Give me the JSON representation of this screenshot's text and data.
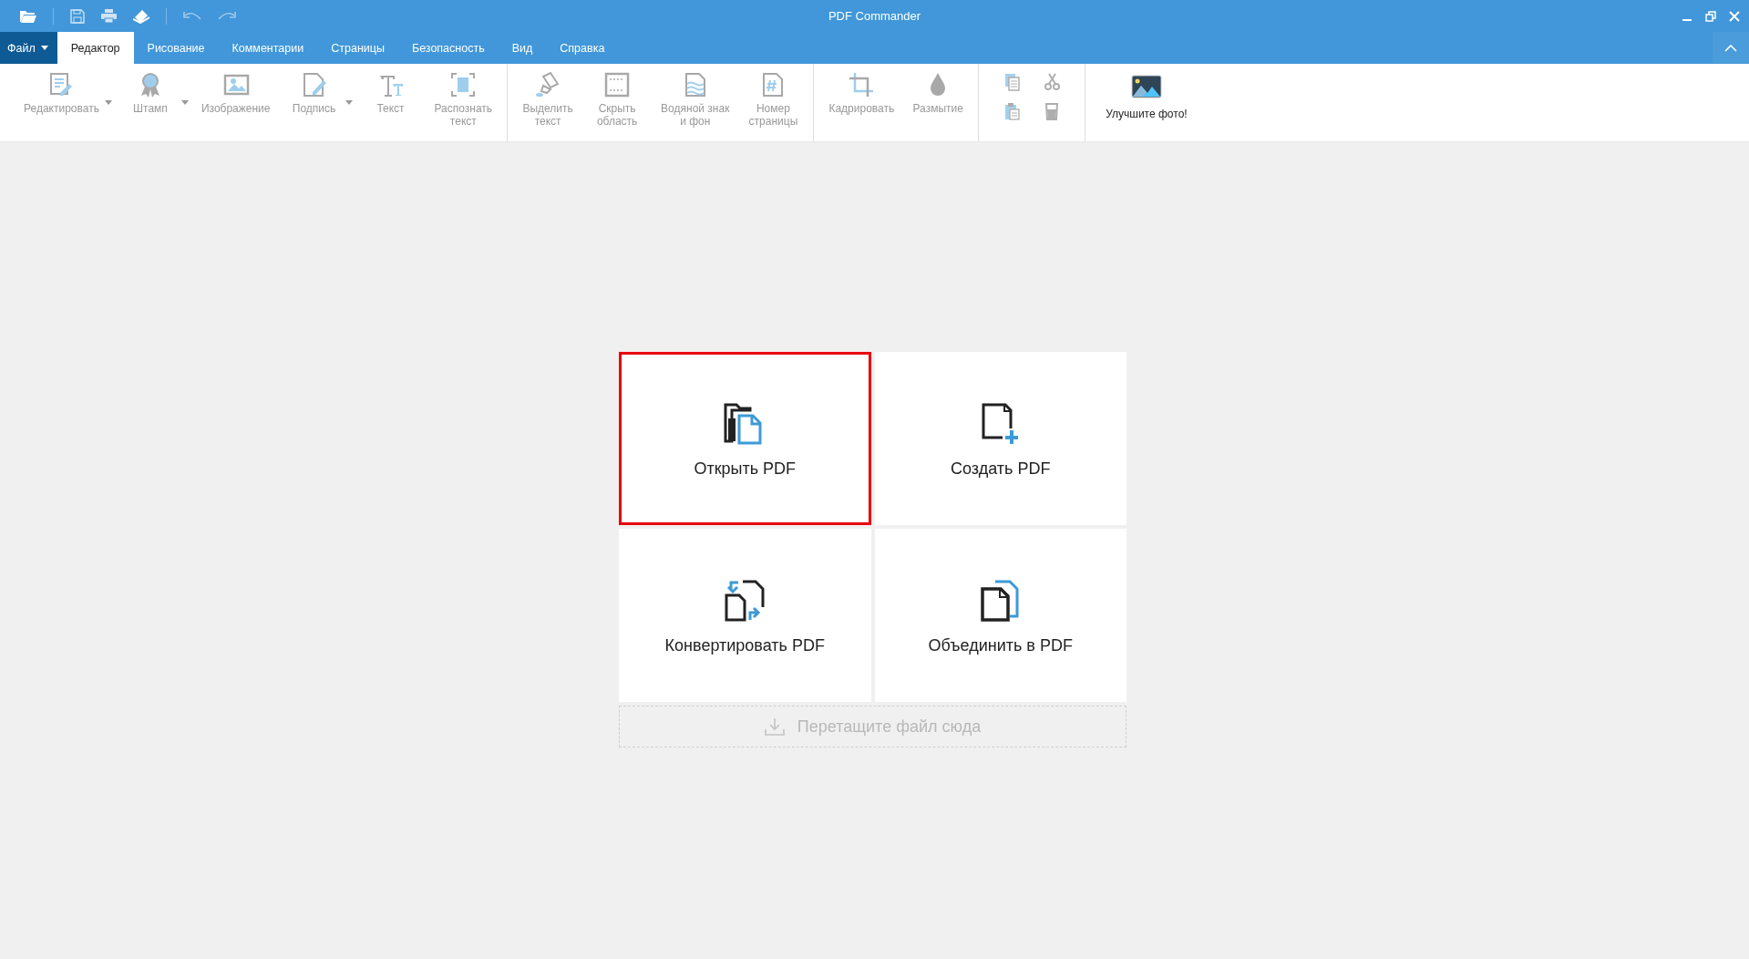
{
  "window": {
    "title": "PDF Commander"
  },
  "file_menu": {
    "label": "Файл"
  },
  "tabs": [
    {
      "label": "Редактор",
      "selected": true
    },
    {
      "label": "Рисование",
      "selected": false
    },
    {
      "label": "Комментарии",
      "selected": false
    },
    {
      "label": "Страницы",
      "selected": false
    },
    {
      "label": "Безопасность",
      "selected": false
    },
    {
      "label": "Вид",
      "selected": false
    },
    {
      "label": "Справка",
      "selected": false
    }
  ],
  "toolbar": {
    "groups": [
      {
        "kind": "large",
        "items": [
          {
            "label": "Редактировать",
            "dropdown": true,
            "disabled": true
          },
          {
            "label": "Штамп",
            "dropdown": true,
            "disabled": true
          },
          {
            "label": "Изображение",
            "dropdown": false,
            "disabled": true
          },
          {
            "label": "Подпись",
            "dropdown": true,
            "disabled": true
          },
          {
            "label": "Текст",
            "dropdown": false,
            "disabled": true
          },
          {
            "label": "Распознать\nтекст",
            "dropdown": false,
            "disabled": true
          }
        ]
      },
      {
        "kind": "large",
        "items": [
          {
            "label": "Выделить\nтекст",
            "dropdown": false,
            "disabled": true
          },
          {
            "label": "Скрыть\nобласть",
            "dropdown": false,
            "disabled": true
          },
          {
            "label": "Водяной знак\nи фон",
            "dropdown": false,
            "disabled": true
          },
          {
            "label": "Номер\nстраницы",
            "dropdown": false,
            "disabled": true
          }
        ]
      },
      {
        "kind": "large",
        "items": [
          {
            "label": "Кадрировать",
            "dropdown": false,
            "disabled": true
          },
          {
            "label": "Размытие",
            "dropdown": false,
            "disabled": true
          }
        ]
      },
      {
        "kind": "small",
        "items": [
          {
            "disabled": true
          },
          {
            "disabled": true
          },
          {
            "disabled": true
          },
          {
            "disabled": true
          }
        ]
      },
      {
        "kind": "large",
        "items": [
          {
            "label": "Улучшите фото!",
            "dropdown": false,
            "disabled": false
          }
        ]
      }
    ]
  },
  "cards": [
    {
      "label": "Открыть PDF",
      "selected": true
    },
    {
      "label": "Создать PDF",
      "selected": false
    },
    {
      "label": "Конвертировать PDF",
      "selected": false
    },
    {
      "label": "Объединить в PDF",
      "selected": false
    }
  ],
  "drop_zone": {
    "label": "Перетащите файл сюда"
  }
}
